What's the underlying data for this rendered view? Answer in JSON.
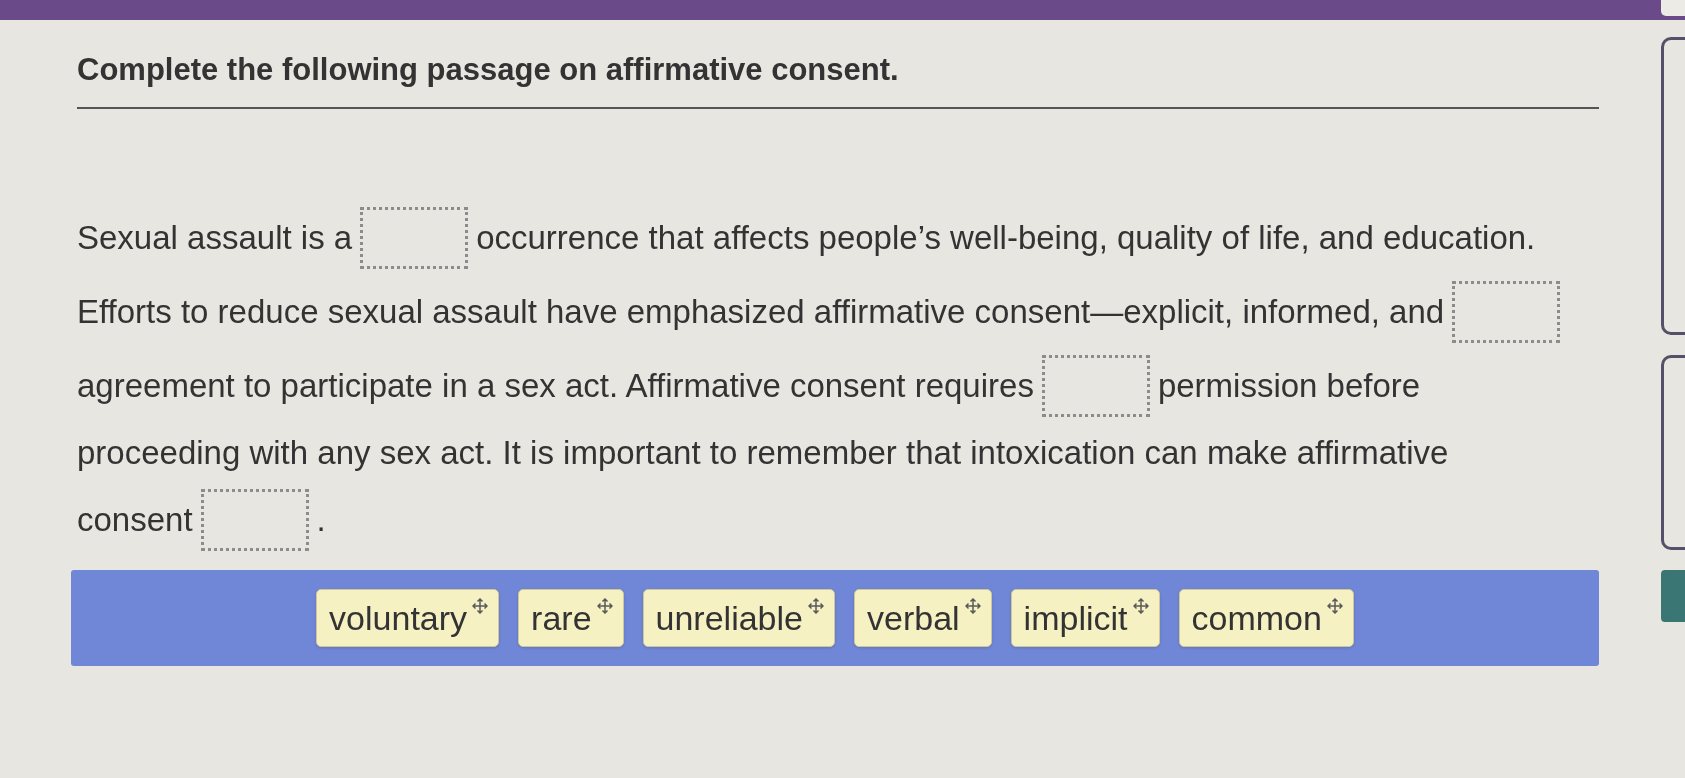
{
  "title": "Complete the following passage on affirmative consent.",
  "passage": {
    "lines": [
      [
        {
          "kind": "text",
          "text": "Sexual assault is a"
        },
        {
          "kind": "blank"
        },
        {
          "kind": "text",
          "text": "occurrence that affects people’s well-being, quality of life, and education."
        }
      ],
      [
        {
          "kind": "text",
          "text": "Efforts to reduce sexual assault have emphasized affirmative consent—explicit, informed, and"
        },
        {
          "kind": "blank"
        }
      ],
      [
        {
          "kind": "text",
          "text": "agreement to participate in a sex act. Affirmative consent requires"
        },
        {
          "kind": "blank"
        },
        {
          "kind": "text",
          "text": "permission before"
        }
      ],
      [
        {
          "kind": "text",
          "text": "proceeding with any sex act. It is important to remember that intoxication can make affirmative"
        }
      ],
      [
        {
          "kind": "text",
          "text": "consent"
        },
        {
          "kind": "blank"
        },
        {
          "kind": "text",
          "text": "."
        }
      ]
    ]
  },
  "answer_bank": {
    "choices": [
      "voluntary",
      "rare",
      "unreliable",
      "verbal",
      "implicit",
      "common"
    ]
  }
}
